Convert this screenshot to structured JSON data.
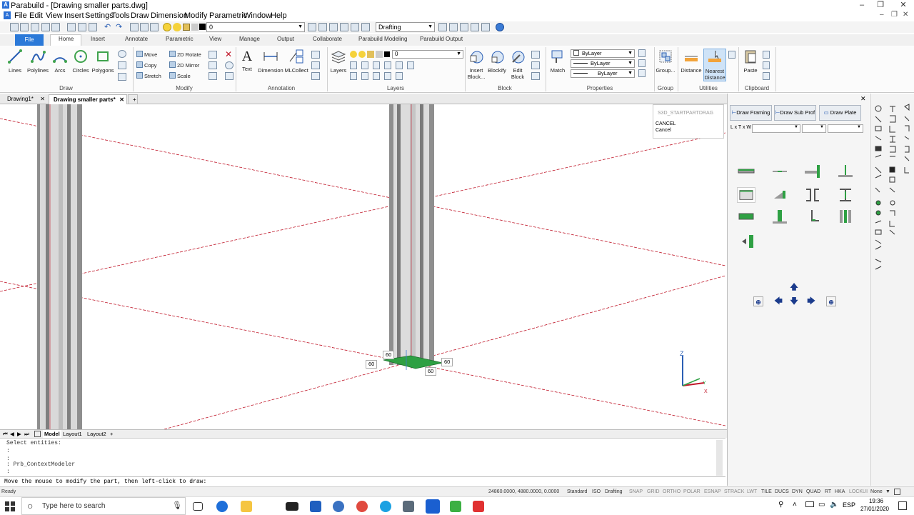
{
  "window": {
    "title": "Parabuild - [Drawing smaller parts.dwg]",
    "app_icon": "A"
  },
  "menubar": [
    "File",
    "Edit",
    "View",
    "Insert",
    "Settings",
    "Tools",
    "Draw",
    "Dimension",
    "Modify",
    "Parametric",
    "Window",
    "Help"
  ],
  "qat": {
    "layer_value": "0",
    "workspace_value": "Drafting"
  },
  "ribbon_tabs": [
    "File",
    "Home",
    "Insert",
    "Annotate",
    "Parametric",
    "View",
    "Manage",
    "Output",
    "Collaborate",
    "Parabuild Modeling",
    "Parabuild Output"
  ],
  "ribbon": {
    "draw": {
      "label": "Draw",
      "buttons": [
        "Lines",
        "Polylines",
        "Arcs",
        "Circles",
        "Polygons"
      ]
    },
    "modify": {
      "label": "Modify",
      "rows": [
        "Move",
        "Copy",
        "Stretch",
        "2D Rotate",
        "2D Mirror",
        "Scale"
      ]
    },
    "annotation": {
      "label": "Annotation",
      "buttons": [
        "Text",
        "Dimension",
        "MLCollect"
      ]
    },
    "layers": {
      "label": "Layers",
      "button": "Layers",
      "layer_value": "0"
    },
    "block": {
      "label": "Block",
      "buttons": [
        "Insert Block...",
        "Blockify",
        "Edit Block"
      ]
    },
    "properties": {
      "label": "Properties",
      "button": "Match",
      "combos": [
        "ByLayer",
        "ByLayer",
        "ByLayer"
      ]
    },
    "group": {
      "label": "Group",
      "button": "Group..."
    },
    "utilities": {
      "label": "Utilities",
      "buttons": [
        "Distance",
        "Nearest Distance"
      ]
    },
    "clipboard": {
      "label": "Clipboard",
      "button": "Paste"
    }
  },
  "doc_tabs": [
    "Drawing1*",
    "Drawing smaller parts*",
    "+"
  ],
  "context_menu": [
    "S3D_STARTPARTDRAG",
    "CANCEL",
    "Cancel"
  ],
  "dimensions": [
    "60",
    "60",
    "60",
    "60"
  ],
  "layout_tabs": [
    "Model",
    "Layout1",
    "Layout2",
    "+"
  ],
  "command_history": [
    "Select entities:",
    ":",
    ":",
    ": Prb_ContextModeler",
    ":"
  ],
  "command_line": "Move the mouse to modify the part, then left-click to draw:",
  "status": {
    "left": "Ready",
    "coords": "24860.0000, 4880.0000, 0.0000",
    "items": [
      "Standard",
      "ISO",
      "Drafting",
      "SNAP",
      "GRID",
      "ORTHO",
      "POLAR",
      "ESNAP",
      "STRACK",
      "LWT",
      "TILE",
      "DUCS",
      "DYN",
      "QUAD",
      "RT",
      "HKA",
      "LOCKUI",
      "None"
    ]
  },
  "palette": {
    "buttons": [
      "Draw Framing",
      "Draw Sub Prof",
      "Draw Plate"
    ],
    "dims_label": "L x T x W"
  },
  "taskbar": {
    "search_placeholder": "Type here to search",
    "time": "19:36",
    "date": "27/01/2020",
    "lang": "ESP"
  },
  "colors": {
    "accent": "#2b79d8",
    "construction_line": "#c0182a",
    "part_green": "#2ea043"
  }
}
